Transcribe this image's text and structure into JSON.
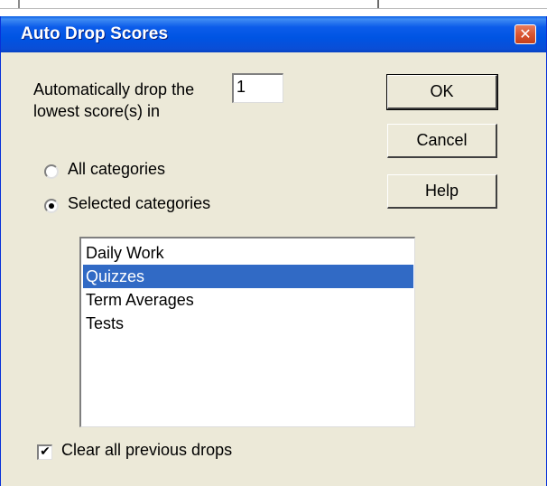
{
  "window": {
    "title": "Auto Drop Scores",
    "close_glyph": "✕"
  },
  "drop_setting": {
    "label_line1": "Automatically drop the",
    "label_line2": "lowest score(s) in",
    "count_value": "1"
  },
  "buttons": {
    "ok": "OK",
    "cancel": "Cancel",
    "help": "Help"
  },
  "scope": {
    "all_label": "All categories",
    "selected_label": "Selected categories",
    "selected_option": "selected"
  },
  "categories": {
    "items": [
      "Daily Work",
      "Quizzes",
      "Term Averages",
      "Tests"
    ],
    "selected_index": 1
  },
  "clear_drops": {
    "label": "Clear all previous drops",
    "checked": true,
    "check_glyph": "✔"
  },
  "colors": {
    "title_bar": "#0054e3",
    "selection": "#316ac5",
    "dialog_bg": "#ece9d8",
    "close_button": "#d8532f"
  }
}
